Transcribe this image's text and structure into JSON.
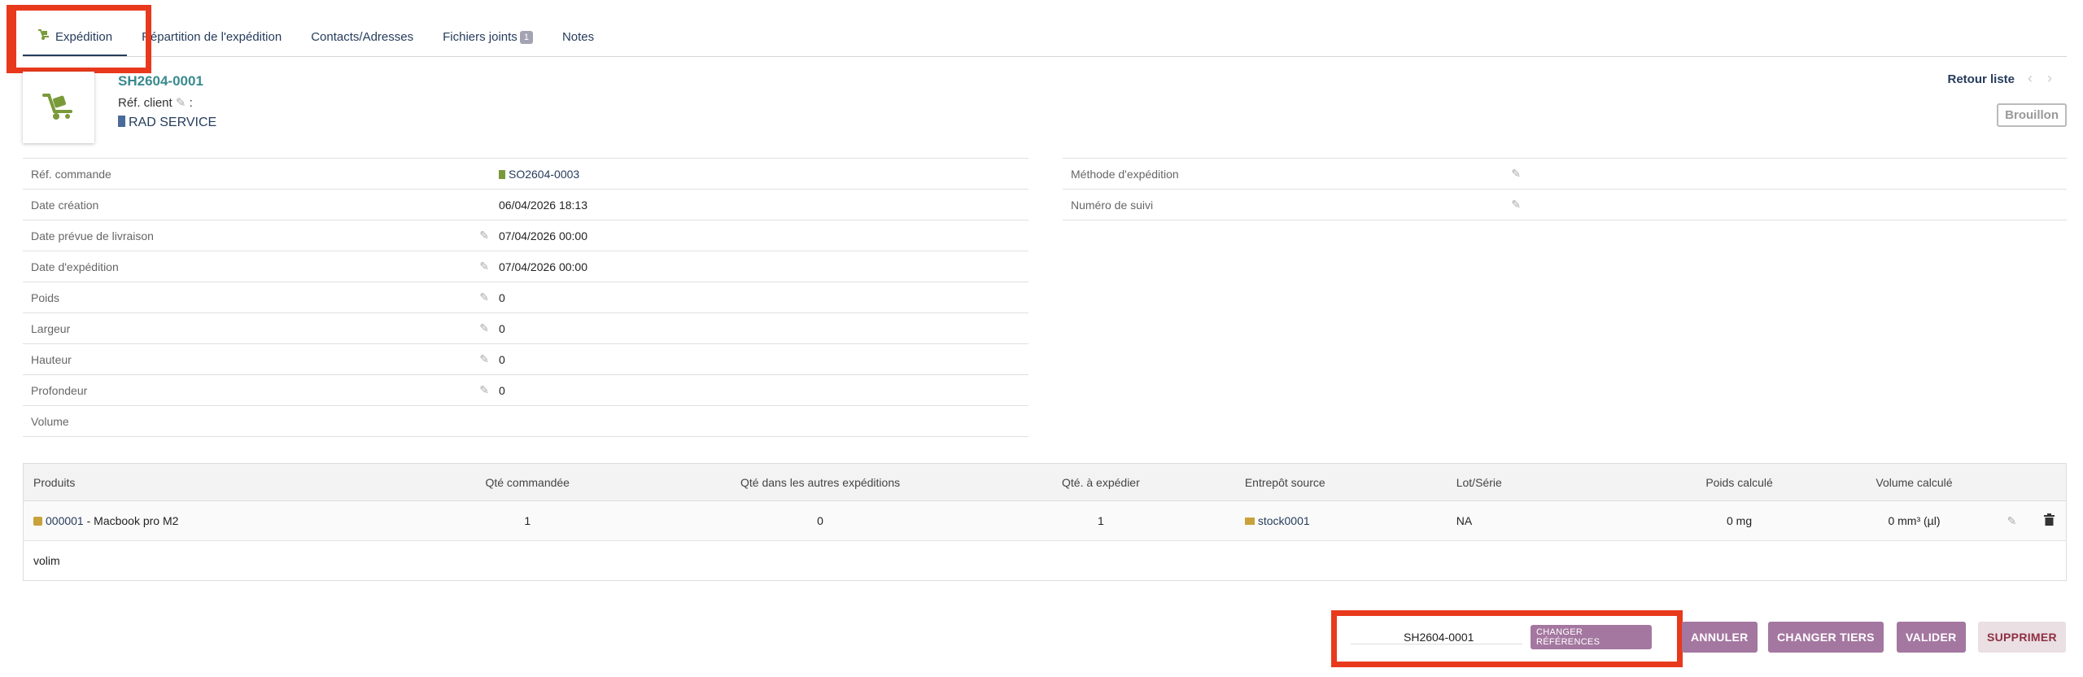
{
  "tabs": [
    {
      "label": "Expédition"
    },
    {
      "label": "Répartition de l'expédition"
    },
    {
      "label": "Contacts/Adresses"
    },
    {
      "label": "Fichiers joints",
      "badge": "1"
    },
    {
      "label": "Notes"
    }
  ],
  "header": {
    "ref": "SH2604-0001",
    "ref_client_label": "Réf. client",
    "ref_client_sep": ":",
    "thirdparty": "RAD SERVICE",
    "back_to_list": "Retour liste",
    "status": "Brouillon"
  },
  "left_fields": [
    {
      "label": "Réf. commande",
      "value": "SO2604-0003"
    },
    {
      "label": "Date création",
      "value": "06/04/2026 18:13"
    },
    {
      "label": "Date prévue de livraison",
      "value": "07/04/2026 00:00"
    },
    {
      "label": "Date d'expédition",
      "value": "07/04/2026 00:00"
    },
    {
      "label": "Poids",
      "value": "0"
    },
    {
      "label": "Largeur",
      "value": "0"
    },
    {
      "label": "Hauteur",
      "value": "0"
    },
    {
      "label": "Profondeur",
      "value": "0"
    },
    {
      "label": "Volume",
      "value": ""
    }
  ],
  "right_fields": [
    {
      "label": "Méthode d'expédition",
      "value": ""
    },
    {
      "label": "Numéro de suivi",
      "value": ""
    }
  ],
  "products": {
    "headers": [
      "Produits",
      "Qté commandée",
      "Qté dans les autres expéditions",
      "Qté. à expédier",
      "Entrepôt source",
      "Lot/Série",
      "Poids calculé",
      "Volume calculé"
    ],
    "row": {
      "ref": "000001",
      "label": " - Macbook pro M2",
      "qty_ordered": "1",
      "qty_other": "0",
      "qty_to_ship": "1",
      "warehouse": "stock0001",
      "lot": "NA",
      "weight": "0 mg",
      "volume": "0 mm³ (µl)"
    },
    "note": "volim"
  },
  "actions": {
    "ref_value": "SH2604-0001",
    "change_refs": "CHANGER RÉFÉRENCES",
    "cancel": "ANNULER",
    "change_thirdparty": "CHANGER TIERS",
    "validate": "VALIDER",
    "delete": "SUPPRIMER"
  },
  "colors": {
    "accent": "#a477a0",
    "link": "#263c5c",
    "highlight": "#e8391d",
    "ref": "#3a8a8e"
  }
}
